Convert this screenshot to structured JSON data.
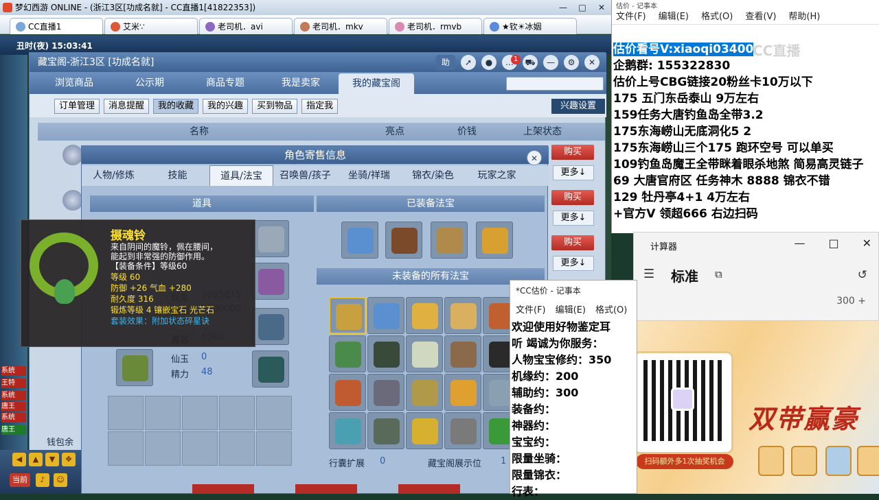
{
  "window": {
    "title": "梦幻西游 ONLINE - (浙江3区[功成名就] - CC直播1[41822353])",
    "controls": [
      "—",
      "□",
      "✕"
    ]
  },
  "browser_tabs": [
    {
      "label": "CC直播1",
      "active": true
    },
    {
      "label": "艾米∵",
      "active": false
    },
    {
      "label": "老司机．avi",
      "active": false
    },
    {
      "label": "老司机．mkv",
      "active": false
    },
    {
      "label": "老司机．rmvb",
      "active": false
    },
    {
      "label": "★钦☀冰姻",
      "active": false
    }
  ],
  "game": {
    "clock": "丑时(夜) 15:03:41",
    "chat_tags": [
      "系统",
      "王特",
      "系统",
      "唐王",
      "系统",
      "唐王"
    ],
    "wallet_label": "钱包余",
    "bottom_labels": [
      "当前"
    ]
  },
  "cbg": {
    "title": "藏宝阁-浙江3区 [功成名就]",
    "help_label": "助",
    "badge_count": "1",
    "nav": [
      "浏览商品",
      "公示期",
      "商品专题",
      "我是卖家",
      "我的藏宝阁"
    ],
    "nav_active": 4,
    "subnav": [
      "订单管理",
      "消息提醒",
      "我的收藏",
      "我的兴趣",
      "买到物品",
      "指定我"
    ],
    "subnav_active": 2,
    "alert_settings": "兴趣设置",
    "list_headers": [
      "名称",
      "亮点",
      "价钱",
      "上架状态"
    ],
    "buy_label": "购买",
    "more_label": "更多↓"
  },
  "role": {
    "title": "角色寄售信息",
    "tabs": [
      "人物/修炼",
      "技能",
      "道具/法宝",
      "召唤兽/孩子",
      "坐骑/祥瑞",
      "锦衣/染色",
      "玩家之家"
    ],
    "active_tab": 2,
    "items_header": "道具",
    "equipped_header": "已装备法宝",
    "unequipped_header": "未装备的所有法宝",
    "stats": [
      {
        "label": "现金",
        "value": "2085875"
      },
      {
        "label": "存银",
        "value": "0000000"
      },
      {
        "label": "善恶",
        "value": "5060"
      },
      {
        "label": "仙玉",
        "value": "0"
      },
      {
        "label": "精力",
        "value": "48"
      }
    ],
    "bag_expand_label": "行囊扩展",
    "bag_expand_value": "0",
    "display_slots_label": "藏宝阁展示位",
    "display_slots_value": "1"
  },
  "tooltip": {
    "name": "摄魂铃",
    "desc1": "来自阴间的魔铃，佩在腰间，",
    "desc2": "能起到非常强的防御作用。",
    "req": "【装备条件】等级60",
    "level": "等级 60",
    "stats": "防御 +26  气血 +280",
    "durability": "耐久度 316",
    "forge": "锻炼等级 4    镶嵌宝石 光芒石",
    "set": "套装效果：附加状态碎星诀"
  },
  "notepad_main": {
    "title": "估价 - 记事本",
    "menu": [
      "文件(F)",
      "编辑(E)",
      "格式(O)",
      "查看(V)",
      "帮助(H)"
    ],
    "lines": [
      "估价看号V:xiaoqi03400",
      "企鹅群:  155322830",
      "估价上号CBG链接20粉丝卡10万以下",
      "175 五门东岳泰山  9万左右",
      "159任务大唐钓鱼岛全带3.2",
      "175东海崂山无底洞化5  2",
      "175东海崂山三个175 跑环空号 可以单买",
      "109钓鱼岛魔王全带眯着眼杀地煞 简易高灵链子",
      "69  大唐官府区 任务神木 8888 锦衣不错",
      "129 牡丹亭4+1 4万左右",
      "+官方V 领超666 右边扫码"
    ],
    "watermark": "CC直播"
  },
  "calculator": {
    "title": "计算器",
    "mode": "标准",
    "expression": "300 +"
  },
  "notepad_small": {
    "title": "*CC估价 - 记事本",
    "menu": [
      "文件(F)",
      "编辑(E)",
      "格式(O)"
    ],
    "lines": [
      "欢迎使用好物鉴定耳",
      "听 竭诚为你服务：",
      "人物宝宝修约：350",
      "机缘约：200",
      "辅助约：300",
      "装备约：",
      "神器约：",
      "宝宝约：",
      "限量坐骑：",
      "限量锦衣：",
      "行表："
    ]
  },
  "promo": {
    "title": "双带赢豪",
    "pill": "扫码额外多1次抽奖机会"
  }
}
